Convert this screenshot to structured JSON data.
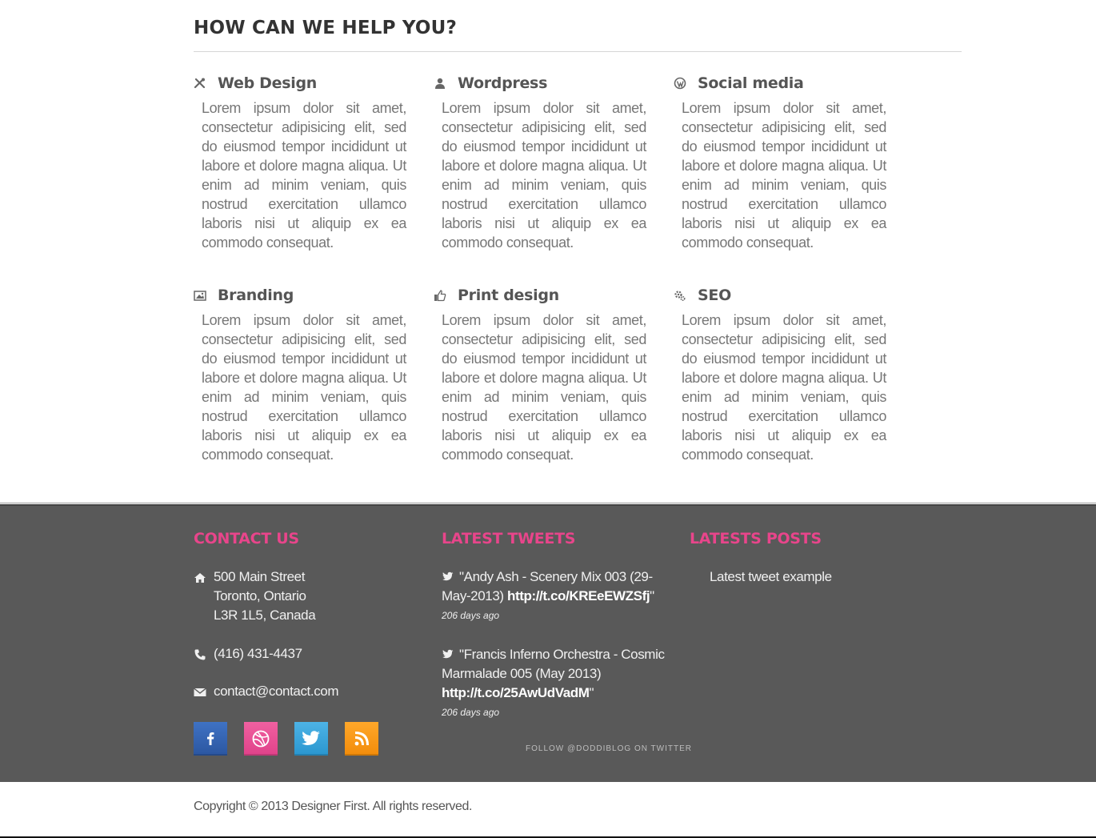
{
  "services": {
    "title": "HOW CAN WE HELP YOU?",
    "items": [
      {
        "title": "Web Design",
        "icon": "tools-icon",
        "text": "Lorem ipsum dolor sit amet, consectetur adipisicing elit, sed do eiusmod tempor incididunt ut labore et dolore magna aliqua. Ut enim ad minim veniam, quis nostrud exercitation ullamco laboris nisi ut aliquip ex ea commodo consequat."
      },
      {
        "title": "Wordpress",
        "icon": "user-icon",
        "text": "Lorem ipsum dolor sit amet, consectetur adipisicing elit, sed do eiusmod tempor incididunt ut labore et dolore magna aliqua. Ut enim ad minim veniam, quis nostrud exercitation ullamco laboris nisi ut aliquip ex ea commodo consequat."
      },
      {
        "title": "Social media",
        "icon": "wordpress-icon",
        "text": "Lorem ipsum dolor sit amet, consectetur adipisicing elit, sed do eiusmod tempor incididunt ut labore et dolore magna aliqua. Ut enim ad minim veniam, quis nostrud exercitation ullamco laboris nisi ut aliquip ex ea commodo consequat."
      },
      {
        "title": "Branding",
        "icon": "picture-icon",
        "text": "Lorem ipsum dolor sit amet, consectetur adipisicing elit, sed do eiusmod tempor incididunt ut labore et dolore magna aliqua. Ut enim ad minim veniam, quis nostrud exercitation ullamco laboris nisi ut aliquip ex ea commodo consequat."
      },
      {
        "title": "Print design",
        "icon": "thumbs-up-icon",
        "text": "Lorem ipsum dolor sit amet, consectetur adipisicing elit, sed do eiusmod tempor incididunt ut labore et dolore magna aliqua. Ut enim ad minim veniam, quis nostrud exercitation ullamco laboris nisi ut aliquip ex ea commodo consequat."
      },
      {
        "title": "SEO",
        "icon": "cogs-icon",
        "text": "Lorem ipsum dolor sit amet, consectetur adipisicing elit, sed do eiusmod tempor incididunt ut labore et dolore magna aliqua. Ut enim ad minim veniam, quis nostrud exercitation ullamco laboris nisi ut aliquip ex ea commodo consequat."
      }
    ]
  },
  "footer": {
    "contact": {
      "title": "CONTACT US",
      "address_line1": "500 Main Street",
      "address_line2": "Toronto, Ontario",
      "address_line3": "L3R 1L5, Canada",
      "phone": "(416) 431-4437",
      "email": "contact@contact.com"
    },
    "social": [
      {
        "name": "facebook",
        "icon": "facebook-icon",
        "color": "#3466b4"
      },
      {
        "name": "dribbble",
        "icon": "dribbble-icon",
        "color": "#e84f94"
      },
      {
        "name": "twitter",
        "icon": "twitter-icon",
        "color": "#35a5dc"
      },
      {
        "name": "rss",
        "icon": "rss-icon",
        "color": "#f8990f"
      }
    ],
    "tweets": {
      "title": "LATEST TWEETS",
      "items": [
        {
          "text": "\"Andy Ash - Scenery Mix 003 (29-May-2013) ",
          "link": "http://t.co/KREeEWZSfj",
          "suffix": "\"",
          "ago": "206 days ago"
        },
        {
          "text": "\"Francis Inferno Orchestra - Cosmic Marmalade 005 (May 2013) ",
          "link": "http://t.co/25AwUdVadM",
          "suffix": "\"",
          "ago": "206 days ago"
        }
      ],
      "follow": "FOLLOW @DODDIBLOG ON TWITTER"
    },
    "posts": {
      "title": "LATESTS POSTS",
      "items": [
        "Latest tweet example"
      ]
    },
    "accent_color": "#e8458b",
    "background_color": "#595959"
  },
  "copyright": "Copyright © 2013 Designer First. All rights reserved."
}
